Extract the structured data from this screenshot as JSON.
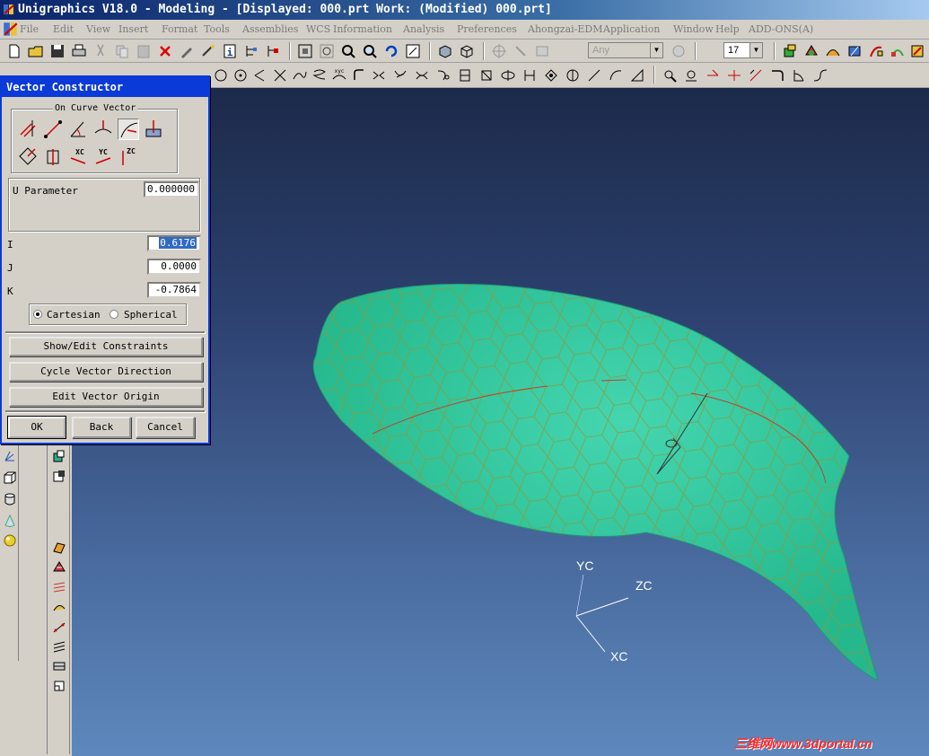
{
  "window": {
    "title": "Unigraphics V18.0 - Modeling - [Displayed: 000.prt   Work:  (Modified) 000.prt]"
  },
  "menu": {
    "items": [
      "File",
      "Edit",
      "View",
      "Insert",
      "Format",
      "Tools",
      "Assemblies",
      "WCS",
      "Information",
      "Analysis",
      "Preferences",
      "Ahongzai-EDM",
      "Application",
      "Window",
      "Help",
      "ADD-ONS(A)"
    ]
  },
  "toolbar": {
    "filter_value": "Any",
    "layer_value": "17"
  },
  "dialog": {
    "title": "Vector Constructor",
    "group_label": "On Curve Vector",
    "axis_icons": [
      "XC",
      "YC",
      "ZC"
    ],
    "u_param_label": "U Parameter",
    "u_param_value": "0.000000",
    "i_label": "I",
    "i_value": "0.6176",
    "j_label": "J",
    "j_value": "0.0000",
    "k_label": "K",
    "k_value": "-0.7864",
    "radio_cartesian": "Cartesian",
    "radio_spherical": "Spherical",
    "selected_mode": "Cartesian",
    "btn_show_edit": "Show/Edit Constraints",
    "btn_cycle": "Cycle Vector Direction",
    "btn_edit_origin": "Edit Vector Origin",
    "btn_ok": "OK",
    "btn_back": "Back",
    "btn_cancel": "Cancel"
  },
  "viewport": {
    "triad": {
      "x": "XC",
      "y": "YC",
      "z": "ZC"
    },
    "surface_color": "#2fc49a",
    "pattern_color": "#8a9a3a",
    "curve_color": "#c0402a"
  },
  "watermark": "三维网www.3dportal.cn"
}
